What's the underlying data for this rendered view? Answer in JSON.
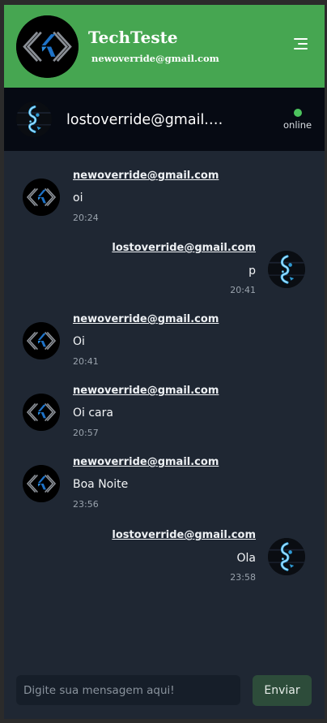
{
  "app": {
    "title": "TechTeste",
    "user_email": "newoverride@gmail.com"
  },
  "chat": {
    "contact_name": "lostoverride@gmail.com",
    "status": "online"
  },
  "messages": [
    {
      "author": "newoverride@gmail.com",
      "text": "oi",
      "time": "20:24",
      "side": "left"
    },
    {
      "author": "lostoverride@gmail.com",
      "text": "p",
      "time": "20:41",
      "side": "right"
    },
    {
      "author": "newoverride@gmail.com",
      "text": "Oi",
      "time": "20:41",
      "side": "left"
    },
    {
      "author": "newoverride@gmail.com",
      "text": "Oi cara",
      "time": "20:57",
      "side": "left"
    },
    {
      "author": "newoverride@gmail.com",
      "text": "Boa Noite",
      "time": "23:56",
      "side": "left"
    },
    {
      "author": "lostoverride@gmail.com",
      "text": "Ola",
      "time": "23:58",
      "side": "right"
    }
  ],
  "composer": {
    "placeholder": "Digite sua mensagem aqui!",
    "send_label": "Enviar"
  },
  "colors": {
    "header": "#46a651",
    "chat_header": "#060a13",
    "background": "#1f2733",
    "online": "#4cc35d",
    "send_button": "#2d4c3a"
  }
}
